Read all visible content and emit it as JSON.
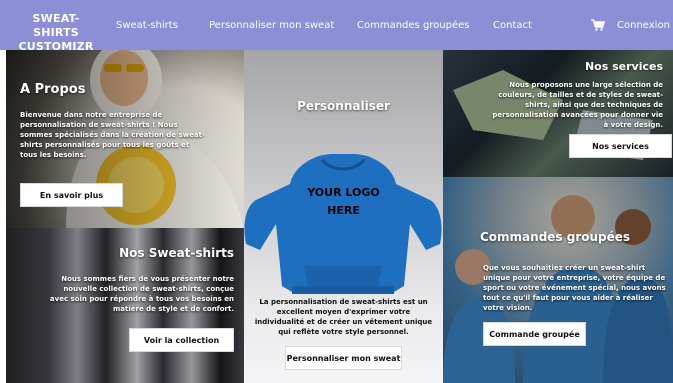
{
  "nav": {
    "brand_line1": "SWEAT-SHIRTS",
    "brand_line2": "CUSTOMIZR",
    "links": [
      "Sweat-shirts",
      "Personnaliser mon sweat",
      "Commandes groupées",
      "Contact"
    ],
    "login": "Connexion"
  },
  "apropos": {
    "title": "A Propos",
    "text": "Bienvenue dans notre entreprise de personnalisation de sweat-shirts ! Nous sommes spécialisés dans la création de sweat-shirts personnalisés pour tous les goûts et tous les besoins.",
    "button": "En savoir plus"
  },
  "collection": {
    "title": "Nos Sweat-shirts",
    "text": "Nous sommes fiers de vous présenter notre nouvelle collection de sweat-shirts, conçue avec soin pour répondre à tous vos besoins en matière de style et de confort.",
    "button": "Voir la collection"
  },
  "perso": {
    "title": "Personnaliser",
    "logo_line1": "YOUR LOGO",
    "logo_line2": "HERE",
    "text": "La personnalisation de sweat-shirts est un excellent moyen d'exprimer votre individualité et de créer un vêtement unique qui reflète votre style personnel.",
    "button": "Personnaliser mon sweat"
  },
  "services": {
    "title": "Nos services",
    "text": "Nous proposons une large sélection de couleurs, de tailles et de styles de sweat-shirts, ainsi que des techniques de personnalisation avancées pour donner vie à votre design.",
    "button": "Nos services"
  },
  "groupes": {
    "title": "Commandes groupées",
    "text": "Que vous souhaitiez créer un sweat-shirt unique pour votre entreprise, votre équipe de sport ou votre événement spécial, nous avons tout ce qu'il faut pour vous aider à réaliser votre vision.",
    "button": "Commande groupée"
  },
  "colors": {
    "nav_bg": "#8b8fd6",
    "hoodie": "#1f6fc0"
  },
  "icons": [
    "cart-icon"
  ]
}
